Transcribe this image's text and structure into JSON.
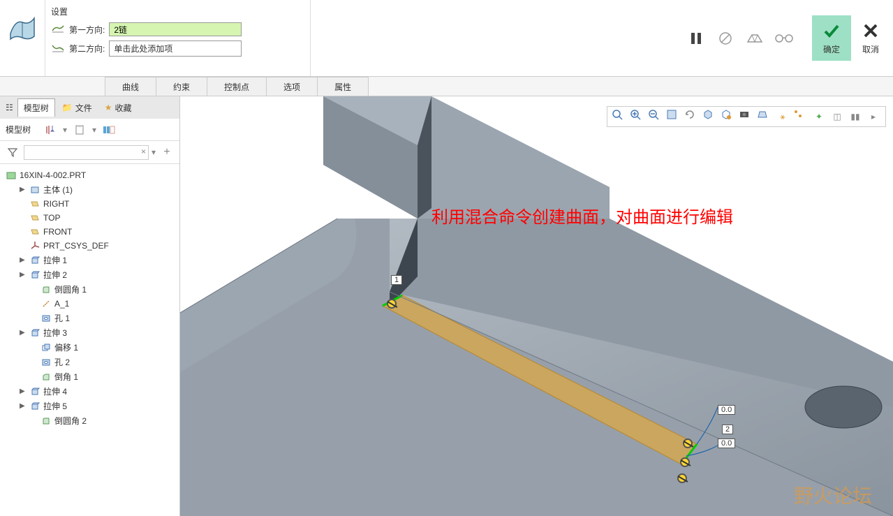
{
  "ribbon": {
    "settings_title": "设置",
    "dir1_label": "第一方向:",
    "dir1_value": "2链",
    "dir2_label": "第二方向:",
    "dir2_placeholder": "单击此处添加项",
    "ok_label": "确定",
    "cancel_label": "取消"
  },
  "dash_tabs": [
    "曲线",
    "约束",
    "控制点",
    "选项",
    "属性"
  ],
  "sidebar": {
    "tab1": "模型树",
    "tab2": "文件",
    "tab3": "收藏",
    "toolbar_label": "模型树",
    "part_name": "16XIN-4-002.PRT",
    "items": [
      {
        "label": "主体 (1)",
        "expandable": true,
        "icon": "body"
      },
      {
        "label": "RIGHT",
        "icon": "plane"
      },
      {
        "label": "TOP",
        "icon": "plane"
      },
      {
        "label": "FRONT",
        "icon": "plane"
      },
      {
        "label": "PRT_CSYS_DEF",
        "icon": "csys"
      },
      {
        "label": "拉伸 1",
        "expandable": true,
        "icon": "extrude"
      },
      {
        "label": "拉伸 2",
        "expandable": true,
        "icon": "extrude"
      },
      {
        "label": "倒圆角 1",
        "icon": "round",
        "indent": true
      },
      {
        "label": "A_1",
        "icon": "axis",
        "indent": true
      },
      {
        "label": "孔 1",
        "icon": "hole",
        "indent": true
      },
      {
        "label": "拉伸 3",
        "expandable": true,
        "icon": "extrude"
      },
      {
        "label": "偏移 1",
        "icon": "offset",
        "indent": true
      },
      {
        "label": "孔 2",
        "icon": "hole",
        "indent": true
      },
      {
        "label": "倒角 1",
        "icon": "chamfer",
        "indent": true
      },
      {
        "label": "拉伸 4",
        "expandable": true,
        "icon": "extrude"
      },
      {
        "label": "拉伸 5",
        "expandable": true,
        "icon": "extrude"
      },
      {
        "label": "倒圆角 2",
        "icon": "round",
        "indent": true
      }
    ]
  },
  "annotation": "利用混合命令创建曲面，对曲面进行编辑",
  "dims": {
    "d1": "1",
    "d2": "0.0",
    "d3": "2",
    "d4": "0.0"
  },
  "watermark": "野火论坛"
}
